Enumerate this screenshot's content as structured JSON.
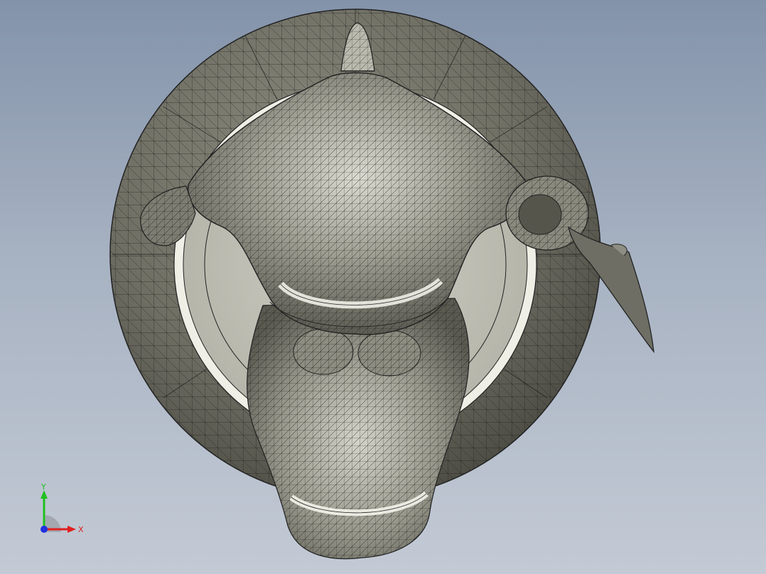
{
  "viewport": {
    "background_top": "#8393aa",
    "background_bottom": "#c3cad5",
    "model_shading": "shaded-with-edges",
    "model_base_color": "#a9a99c"
  },
  "triad": {
    "x_label": "X",
    "y_label": "Y",
    "x_color": "#e02020",
    "y_color": "#20c020",
    "z_color": "#2030e0"
  }
}
